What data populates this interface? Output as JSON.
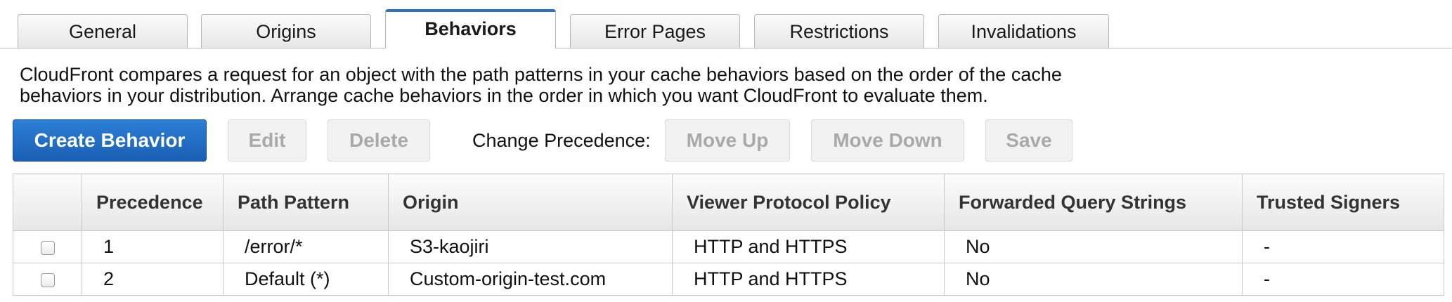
{
  "tabs": [
    "General",
    "Origins",
    "Behaviors",
    "Error Pages",
    "Restrictions",
    "Invalidations"
  ],
  "active_tab": "Behaviors",
  "description": {
    "line1": "CloudFront compares a request for an object with the path patterns in your cache behaviors based on the order of the cache",
    "line2": "behaviors in your distribution. Arrange cache behaviors in the order in which you want CloudFront to evaluate them."
  },
  "toolbar": {
    "create_label": "Create Behavior",
    "edit_label": "Edit",
    "delete_label": "Delete",
    "change_precedence_label": "Change Precedence:",
    "move_up_label": "Move Up",
    "move_down_label": "Move Down",
    "save_label": "Save"
  },
  "table": {
    "headers": [
      "Precedence",
      "Path Pattern",
      "Origin",
      "Viewer Protocol Policy",
      "Forwarded Query Strings",
      "Trusted Signers"
    ],
    "rows": [
      {
        "precedence": "1",
        "path": "/error/*",
        "origin": "S3-kaojiri",
        "protocol": "HTTP and HTTPS",
        "query": "No",
        "signers": "-"
      },
      {
        "precedence": "2",
        "path": "Default (*)",
        "origin": "Custom-origin-test.com",
        "protocol": "HTTP and HTTPS",
        "query": "No",
        "signers": "-"
      }
    ]
  },
  "colors": {
    "accent": "#2f72c3",
    "primary_button": "#1f6cc4",
    "disabled_text": "#a9a9a9"
  }
}
